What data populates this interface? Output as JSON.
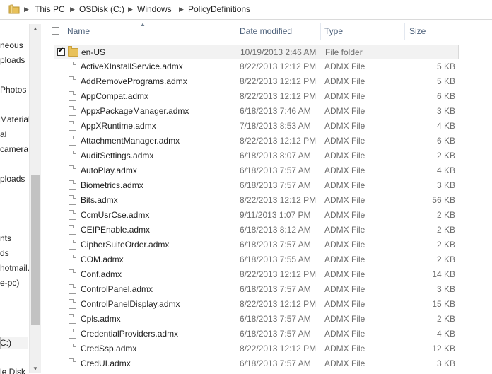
{
  "address": {
    "crumbs": [
      "This PC",
      "OSDisk (C:)",
      "Windows",
      "PolicyDefinitions"
    ]
  },
  "nav": {
    "items": [
      "neous",
      "ploads",
      "Photos",
      "Material",
      "al",
      "camera",
      "ploads",
      "nts",
      "ds",
      "hotmail.",
      "e-pc)",
      "C:)",
      "le Disk"
    ]
  },
  "columns": {
    "name": "Name",
    "date": "Date modified",
    "type": "Type",
    "size": "Size"
  },
  "rows": [
    {
      "name": "en-US",
      "date": "10/19/2013 2:46 AM",
      "type": "File folder",
      "size": "",
      "kind": "folder"
    },
    {
      "name": "ActiveXInstallService.admx",
      "date": "8/22/2013 12:12 PM",
      "type": "ADMX File",
      "size": "5 KB"
    },
    {
      "name": "AddRemovePrograms.admx",
      "date": "8/22/2013 12:12 PM",
      "type": "ADMX File",
      "size": "5 KB"
    },
    {
      "name": "AppCompat.admx",
      "date": "8/22/2013 12:12 PM",
      "type": "ADMX File",
      "size": "6 KB"
    },
    {
      "name": "AppxPackageManager.admx",
      "date": "6/18/2013 7:46 AM",
      "type": "ADMX File",
      "size": "3 KB"
    },
    {
      "name": "AppXRuntime.admx",
      "date": "7/18/2013 8:53 AM",
      "type": "ADMX File",
      "size": "4 KB"
    },
    {
      "name": "AttachmentManager.admx",
      "date": "8/22/2013 12:12 PM",
      "type": "ADMX File",
      "size": "6 KB"
    },
    {
      "name": "AuditSettings.admx",
      "date": "6/18/2013 8:07 AM",
      "type": "ADMX File",
      "size": "2 KB"
    },
    {
      "name": "AutoPlay.admx",
      "date": "6/18/2013 7:57 AM",
      "type": "ADMX File",
      "size": "4 KB"
    },
    {
      "name": "Biometrics.admx",
      "date": "6/18/2013 7:57 AM",
      "type": "ADMX File",
      "size": "3 KB"
    },
    {
      "name": "Bits.admx",
      "date": "8/22/2013 12:12 PM",
      "type": "ADMX File",
      "size": "56 KB"
    },
    {
      "name": "CcmUsrCse.admx",
      "date": "9/11/2013 1:07 PM",
      "type": "ADMX File",
      "size": "2 KB"
    },
    {
      "name": "CEIPEnable.admx",
      "date": "6/18/2013 8:12 AM",
      "type": "ADMX File",
      "size": "2 KB"
    },
    {
      "name": "CipherSuiteOrder.admx",
      "date": "6/18/2013 7:57 AM",
      "type": "ADMX File",
      "size": "2 KB"
    },
    {
      "name": "COM.admx",
      "date": "6/18/2013 7:55 AM",
      "type": "ADMX File",
      "size": "2 KB"
    },
    {
      "name": "Conf.admx",
      "date": "8/22/2013 12:12 PM",
      "type": "ADMX File",
      "size": "14 KB"
    },
    {
      "name": "ControlPanel.admx",
      "date": "6/18/2013 7:57 AM",
      "type": "ADMX File",
      "size": "3 KB"
    },
    {
      "name": "ControlPanelDisplay.admx",
      "date": "8/22/2013 12:12 PM",
      "type": "ADMX File",
      "size": "15 KB"
    },
    {
      "name": "Cpls.admx",
      "date": "6/18/2013 7:57 AM",
      "type": "ADMX File",
      "size": "2 KB"
    },
    {
      "name": "CredentialProviders.admx",
      "date": "6/18/2013 7:57 AM",
      "type": "ADMX File",
      "size": "4 KB"
    },
    {
      "name": "CredSsp.admx",
      "date": "8/22/2013 12:12 PM",
      "type": "ADMX File",
      "size": "12 KB"
    },
    {
      "name": "CredUI.admx",
      "date": "6/18/2013 7:57 AM",
      "type": "ADMX File",
      "size": "3 KB"
    }
  ]
}
